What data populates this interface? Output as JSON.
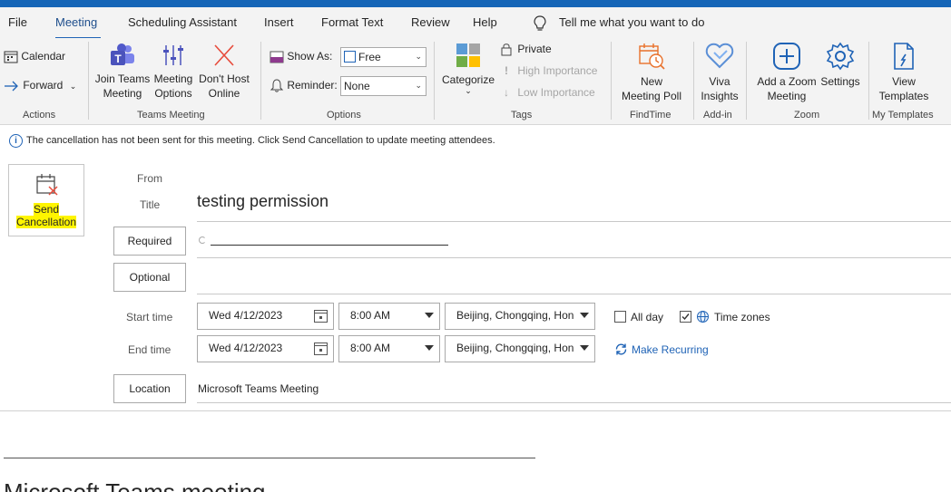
{
  "menu": {
    "tabs": [
      "File",
      "Meeting",
      "Scheduling Assistant",
      "Insert",
      "Format Text",
      "Review",
      "Help"
    ],
    "active_tab": "Meeting",
    "tell_me": "Tell me what you want to do"
  },
  "ribbon": {
    "actions": {
      "calendar": "Calendar",
      "forward": "Forward",
      "group": "Actions"
    },
    "teams": {
      "join_line1": "Join Teams",
      "join_line2": "Meeting",
      "options_line1": "Meeting",
      "options_line2": "Options",
      "host_line1": "Don't Host",
      "host_line2": "Online",
      "group": "Teams Meeting"
    },
    "options": {
      "show_as_label": "Show As:",
      "show_as_value": "Free",
      "reminder_label": "Reminder:",
      "reminder_value": "None",
      "group": "Options"
    },
    "tags": {
      "categorize": "Categorize",
      "private": "Private",
      "high": "High Importance",
      "low": "Low Importance",
      "group": "Tags"
    },
    "findtime": {
      "line1": "New",
      "line2": "Meeting Poll",
      "group": "FindTime"
    },
    "addin": {
      "line1": "Viva",
      "line2": "Insights",
      "group": "Add-in"
    },
    "zoom": {
      "add_line1": "Add a Zoom",
      "add_line2": "Meeting",
      "settings": "Settings",
      "group": "Zoom"
    },
    "templates": {
      "line1": "View",
      "line2": "Templates",
      "group": "My Templates"
    }
  },
  "colors": {
    "accent": "#1f63b6",
    "titlebar": "#1565b7",
    "highlight": "#fff500",
    "zoom": "#1f63b6",
    "findtime": "#e8702a"
  },
  "info_bar": {
    "text": "The cancellation has not been sent for this meeting. Click Send Cancellation to update meeting attendees."
  },
  "send": {
    "line1": "Send",
    "line2": "Cancellation"
  },
  "form": {
    "from_label": "From",
    "title_label": "Title",
    "title_value": "testing permission",
    "required_label": "Required",
    "optional_label": "Optional",
    "start_label": "Start time",
    "end_label": "End time",
    "start_date": "Wed 4/12/2023",
    "start_time": "8:00 AM",
    "start_tz": "Beijing, Chongqing, Hon",
    "end_date": "Wed 4/12/2023",
    "end_time": "8:00 AM",
    "end_tz": "Beijing, Chongqing, Hon",
    "all_day": "All day",
    "time_zones": "Time zones",
    "make_recurring": "Make Recurring",
    "location_label": "Location",
    "location_value": "Microsoft Teams Meeting"
  },
  "body": {
    "heading": "Microsoft Teams meeting"
  }
}
